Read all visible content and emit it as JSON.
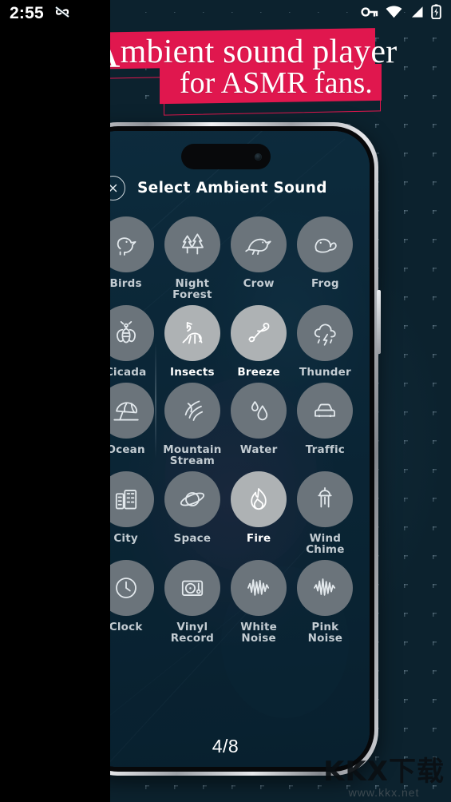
{
  "statusbar": {
    "time": "2:55",
    "left_icons": [
      {
        "name": "infinity-data-saver-icon"
      }
    ],
    "right_icons": [
      {
        "name": "vpn-key-icon"
      },
      {
        "name": "wifi-icon"
      },
      {
        "name": "cellular-signal-icon"
      },
      {
        "name": "battery-charging-icon"
      }
    ]
  },
  "promo": {
    "line1_cap": "A",
    "line1_rest": "mbient sound player",
    "line2": "for ASMR fans.",
    "banner_color": "#e0174e"
  },
  "app": {
    "close_label": "×",
    "title": "Select Ambient Sound",
    "page_indicator": "4/8",
    "colors": {
      "bubble": "#6b747b",
      "bubble_active": "#aeb2b4",
      "label": "#c3ccd2",
      "label_active": "#ffffff",
      "screen_bg": "#0d2a3c"
    },
    "sounds": [
      {
        "label": "Birds",
        "icon": "bird-chick-icon",
        "selected": false
      },
      {
        "label": "Night\nForest",
        "icon": "pine-trees-icon",
        "selected": false
      },
      {
        "label": "Crow",
        "icon": "crow-bird-icon",
        "selected": false
      },
      {
        "label": "Frog",
        "icon": "frog-icon",
        "selected": false
      },
      {
        "label": "Cicada",
        "icon": "cicada-bug-icon",
        "selected": false
      },
      {
        "label": "Insects",
        "icon": "insects-cricket-icon",
        "selected": true
      },
      {
        "label": "Breeze",
        "icon": "breeze-wind-icon",
        "selected": true
      },
      {
        "label": "Thunder",
        "icon": "thunder-cloud-icon",
        "selected": false
      },
      {
        "label": "Ocean",
        "icon": "beach-umbrella-icon",
        "selected": false
      },
      {
        "label": "Mountain\nStream",
        "icon": "stream-waves-icon",
        "selected": false
      },
      {
        "label": "Water",
        "icon": "water-droplets-icon",
        "selected": false
      },
      {
        "label": "Traffic",
        "icon": "car-traffic-icon",
        "selected": false
      },
      {
        "label": "City",
        "icon": "city-buildings-icon",
        "selected": false
      },
      {
        "label": "Space",
        "icon": "planet-saturn-icon",
        "selected": false
      },
      {
        "label": "Fire",
        "icon": "fire-flame-icon",
        "selected": true
      },
      {
        "label": "Wind\nChime",
        "icon": "wind-chime-icon",
        "selected": false
      },
      {
        "label": "Clock",
        "icon": "clock-icon",
        "selected": false
      },
      {
        "label": "Vinyl\nRecord",
        "icon": "vinyl-turntable-icon",
        "selected": false
      },
      {
        "label": "White\nNoise",
        "icon": "white-noise-wave-icon",
        "selected": false
      },
      {
        "label": "Pink\nNoise",
        "icon": "pink-noise-wave-icon",
        "selected": false
      }
    ]
  },
  "watermark": {
    "main": "KKX下载",
    "sub": "www.kkx.net"
  }
}
